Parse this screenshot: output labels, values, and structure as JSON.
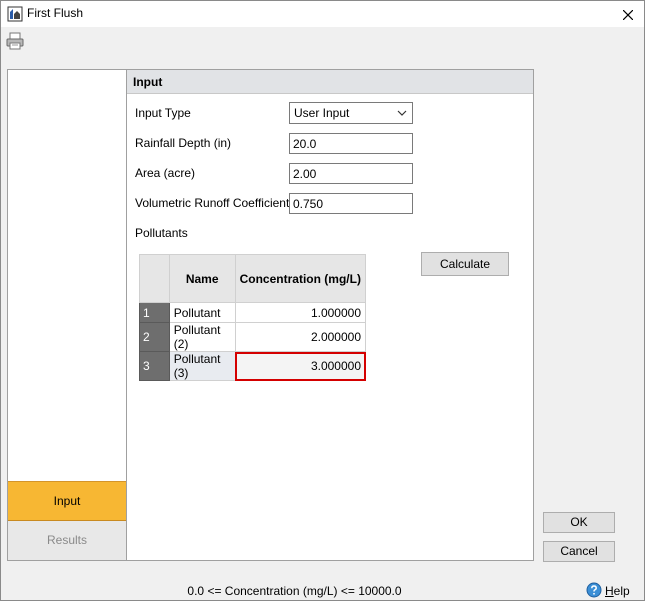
{
  "window": {
    "title": "First Flush"
  },
  "icons": {
    "app": "app-icon",
    "close": "close-icon",
    "print": "printer-icon",
    "dropdown": "chevron-down-icon",
    "help": "help-icon"
  },
  "nav": {
    "input_label": "Input",
    "results_label": "Results",
    "active_color": "#f7b733"
  },
  "section": {
    "title": "Input"
  },
  "fields": {
    "input_type": {
      "label": "Input Type",
      "value": "User Input"
    },
    "rainfall_depth": {
      "label": "Rainfall Depth (in)",
      "value": "20.0"
    },
    "area": {
      "label": "Area (acre)",
      "value": "2.00"
    },
    "runoff_coefficient": {
      "label": "Volumetric Runoff Coefficient",
      "value": "0.750"
    }
  },
  "pollutants": {
    "label": "Pollutants",
    "columns": [
      "Name",
      "Concentration (mg/L)"
    ],
    "rows": [
      {
        "num": "1",
        "name": "Pollutant",
        "concentration": "1.000000"
      },
      {
        "num": "2",
        "name": "Pollutant (2)",
        "concentration": "2.000000"
      },
      {
        "num": "3",
        "name": "Pollutant (3)",
        "concentration": "3.000000"
      }
    ],
    "error_color": "#d40000"
  },
  "buttons": {
    "calculate": "Calculate",
    "ok": "OK",
    "cancel": "Cancel"
  },
  "status": {
    "text": "0.0 <= Concentration (mg/L) <= 10000.0"
  },
  "help": {
    "label_first": "H",
    "label_rest": "elp"
  }
}
